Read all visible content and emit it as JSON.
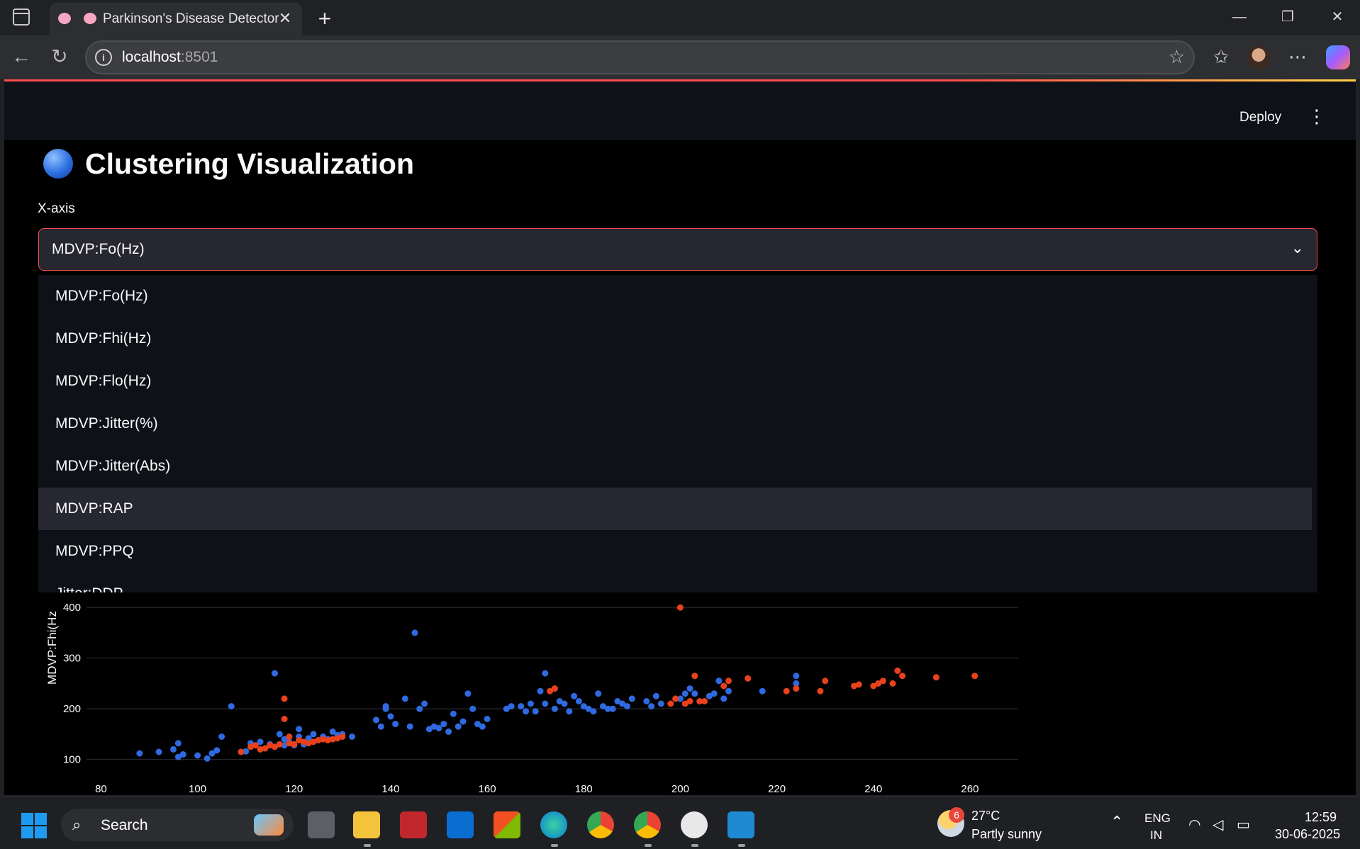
{
  "browser": {
    "tab_title": "Parkinson's Disease Detector",
    "url_host": "localhost",
    "url_port": ":8501"
  },
  "app": {
    "deploy_label": "Deploy",
    "title": "Clustering Visualization",
    "xaxis_label": "X-axis",
    "xaxis_selected": "MDVP:Fo(Hz)",
    "dropdown_options": [
      "MDVP:Fo(Hz)",
      "MDVP:Fhi(Hz)",
      "MDVP:Flo(Hz)",
      "MDVP:Jitter(%)",
      "MDVP:Jitter(Abs)",
      "MDVP:RAP",
      "MDVP:PPQ",
      "Jitter:DDP"
    ],
    "highlighted_option": "MDVP:RAP"
  },
  "chart_data": {
    "type": "scatter",
    "ylabel": "MDVP:Fhi(Hz",
    "xlim": [
      77,
      270
    ],
    "ylim": [
      80,
      410
    ],
    "x_ticks": [
      80,
      100,
      120,
      140,
      160,
      180,
      200,
      220,
      240,
      260
    ],
    "y_ticks": [
      100,
      200,
      300,
      400
    ],
    "colors": {
      "blue": "#2f6ae0",
      "red": "#e8411b"
    },
    "series": [
      {
        "color": "blue",
        "points": [
          [
            88,
            112
          ],
          [
            92,
            115
          ],
          [
            95,
            120
          ],
          [
            96,
            105
          ],
          [
            96,
            132
          ],
          [
            97,
            110
          ],
          [
            100,
            108
          ],
          [
            102,
            102
          ],
          [
            103,
            112
          ],
          [
            104,
            118
          ],
          [
            105,
            145
          ],
          [
            107,
            205
          ],
          [
            109,
            115
          ],
          [
            110,
            116
          ],
          [
            111,
            132
          ],
          [
            112,
            128
          ],
          [
            113,
            135
          ],
          [
            114,
            122
          ],
          [
            115,
            130
          ],
          [
            116,
            270
          ],
          [
            117,
            150
          ],
          [
            118,
            128
          ],
          [
            118,
            140
          ],
          [
            119,
            135
          ],
          [
            120,
            128
          ],
          [
            121,
            145
          ],
          [
            121,
            160
          ],
          [
            122,
            130
          ],
          [
            123,
            142
          ],
          [
            124,
            150
          ],
          [
            125,
            138
          ],
          [
            126,
            145
          ],
          [
            127,
            140
          ],
          [
            128,
            155
          ],
          [
            129,
            148
          ],
          [
            130,
            150
          ],
          [
            132,
            145
          ],
          [
            137,
            178
          ],
          [
            138,
            165
          ],
          [
            139,
            200
          ],
          [
            139,
            205
          ],
          [
            140,
            185
          ],
          [
            141,
            170
          ],
          [
            143,
            220
          ],
          [
            144,
            165
          ],
          [
            145,
            350
          ],
          [
            146,
            200
          ],
          [
            147,
            210
          ],
          [
            148,
            160
          ],
          [
            149,
            165
          ],
          [
            150,
            162
          ],
          [
            151,
            170
          ],
          [
            152,
            155
          ],
          [
            153,
            190
          ],
          [
            154,
            165
          ],
          [
            155,
            175
          ],
          [
            156,
            230
          ],
          [
            157,
            200
          ],
          [
            158,
            170
          ],
          [
            159,
            165
          ],
          [
            160,
            180
          ],
          [
            164,
            200
          ],
          [
            165,
            205
          ],
          [
            167,
            205
          ],
          [
            168,
            195
          ],
          [
            169,
            210
          ],
          [
            170,
            195
          ],
          [
            171,
            235
          ],
          [
            172,
            270
          ],
          [
            172,
            210
          ],
          [
            174,
            200
          ],
          [
            175,
            215
          ],
          [
            176,
            210
          ],
          [
            177,
            195
          ],
          [
            178,
            225
          ],
          [
            179,
            215
          ],
          [
            180,
            205
          ],
          [
            181,
            200
          ],
          [
            182,
            195
          ],
          [
            183,
            230
          ],
          [
            184,
            205
          ],
          [
            185,
            200
          ],
          [
            186,
            200
          ],
          [
            187,
            215
          ],
          [
            188,
            210
          ],
          [
            189,
            205
          ],
          [
            190,
            220
          ],
          [
            193,
            215
          ],
          [
            194,
            205
          ],
          [
            195,
            225
          ],
          [
            196,
            210
          ],
          [
            200,
            220
          ],
          [
            201,
            230
          ],
          [
            202,
            240
          ],
          [
            203,
            230
          ],
          [
            206,
            225
          ],
          [
            207,
            230
          ],
          [
            208,
            255
          ],
          [
            209,
            220
          ],
          [
            210,
            235
          ],
          [
            217,
            235
          ],
          [
            224,
            250
          ],
          [
            224,
            265
          ]
        ]
      },
      {
        "color": "red",
        "points": [
          [
            109,
            115
          ],
          [
            111,
            125
          ],
          [
            112,
            128
          ],
          [
            113,
            120
          ],
          [
            114,
            122
          ],
          [
            115,
            128
          ],
          [
            116,
            125
          ],
          [
            117,
            130
          ],
          [
            118,
            220
          ],
          [
            118,
            180
          ],
          [
            119,
            132
          ],
          [
            119,
            145
          ],
          [
            120,
            130
          ],
          [
            121,
            138
          ],
          [
            122,
            135
          ],
          [
            123,
            132
          ],
          [
            124,
            135
          ],
          [
            125,
            138
          ],
          [
            126,
            140
          ],
          [
            127,
            138
          ],
          [
            128,
            140
          ],
          [
            129,
            142
          ],
          [
            130,
            145
          ],
          [
            173,
            235
          ],
          [
            174,
            240
          ],
          [
            198,
            210
          ],
          [
            199,
            220
          ],
          [
            200,
            400
          ],
          [
            201,
            210
          ],
          [
            202,
            215
          ],
          [
            203,
            265
          ],
          [
            204,
            215
          ],
          [
            205,
            215
          ],
          [
            209,
            245
          ],
          [
            210,
            255
          ],
          [
            214,
            260
          ],
          [
            222,
            235
          ],
          [
            224,
            240
          ],
          [
            229,
            235
          ],
          [
            230,
            255
          ],
          [
            236,
            245
          ],
          [
            237,
            248
          ],
          [
            240,
            245
          ],
          [
            241,
            250
          ],
          [
            242,
            255
          ],
          [
            244,
            250
          ],
          [
            245,
            275
          ],
          [
            246,
            265
          ],
          [
            253,
            262
          ],
          [
            261,
            265
          ]
        ]
      }
    ]
  },
  "taskbar": {
    "search_label": "Search",
    "weather_badge": "6",
    "weather_temp": "27°C",
    "weather_desc": "Partly sunny",
    "lang_line1": "ENG",
    "lang_line2": "IN",
    "time": "12:59",
    "date": "30-06-2025"
  }
}
